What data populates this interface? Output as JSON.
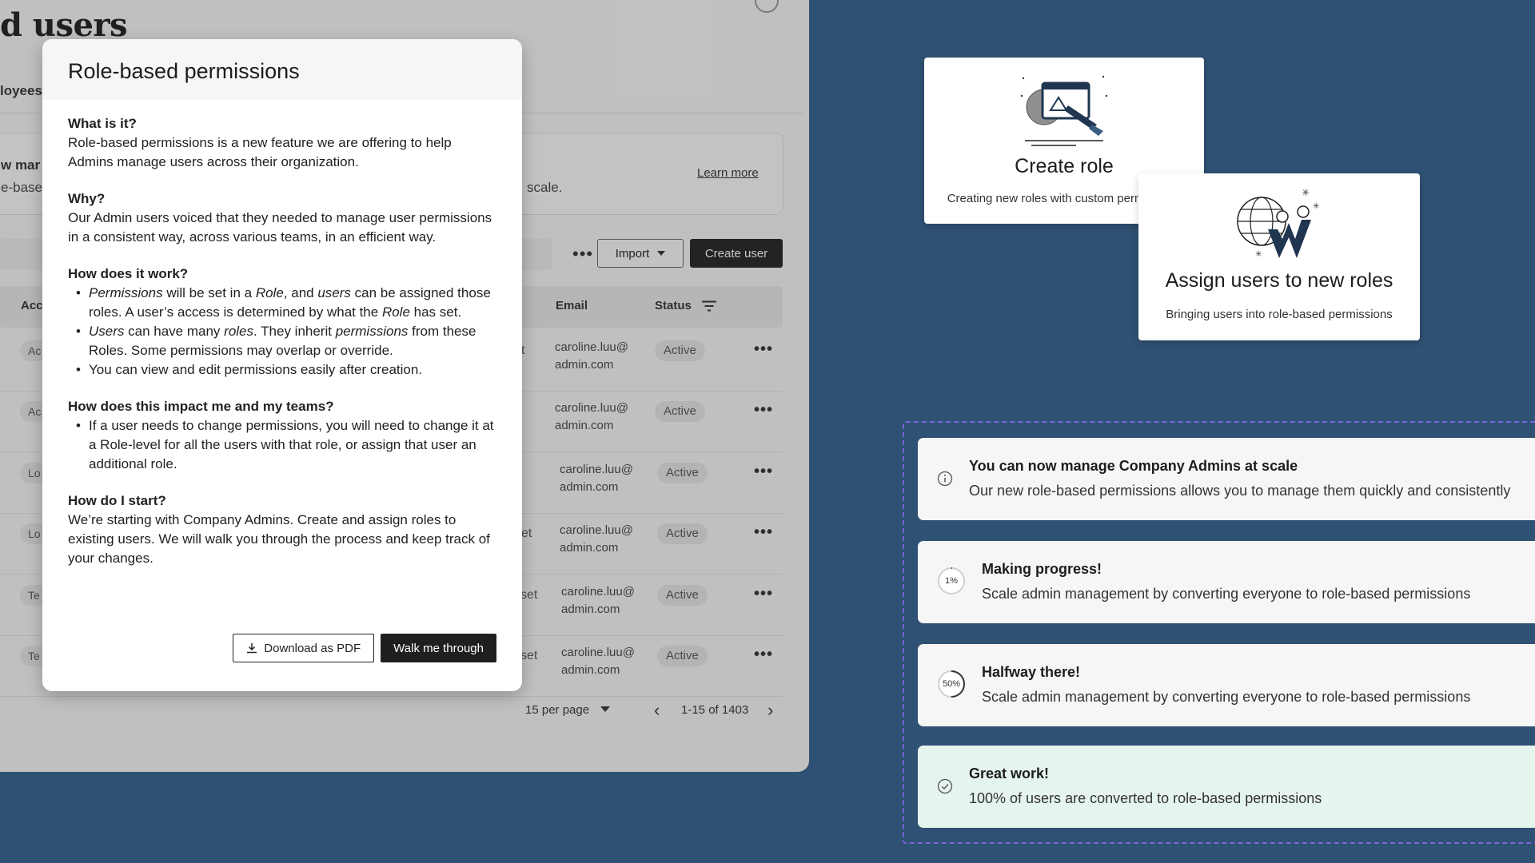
{
  "app": {
    "page_title": "d users",
    "tab_employees": "loyees",
    "banner": {
      "title": "w mar",
      "desc_left": "e-base",
      "desc_right": "scale.",
      "learn_more": "Learn more"
    },
    "toolbar": {
      "more": "•••",
      "import_label": "Import",
      "create_user_label": "Create user"
    },
    "table": {
      "columns": {
        "access": "Acc",
        "email": "Email",
        "status": "Status"
      },
      "rows": [
        {
          "access": "Ac",
          "extra": "t",
          "email": "caroline.luu@ admin.com",
          "status": "Active"
        },
        {
          "access": "Ac",
          "extra": "",
          "email": "caroline.luu@ admin.com",
          "status": "Active"
        },
        {
          "access": "Lo",
          "extra": "",
          "email": "caroline.luu@ admin.com",
          "status": "Active"
        },
        {
          "access": "Lo",
          "extra": "et",
          "email": "caroline.luu@ admin.com",
          "status": "Active"
        },
        {
          "access": "Te",
          "extra": "set",
          "email": "caroline.luu@ admin.com",
          "status": "Active"
        },
        {
          "access": "Te",
          "extra": "set",
          "email": "caroline.luu@ admin.com",
          "status": "Active"
        }
      ],
      "row_menu": "•••"
    },
    "pagination": {
      "per_page": "15 per page",
      "range": "1-15 of 1403",
      "prev": "‹",
      "next": "›"
    }
  },
  "modal": {
    "title": "Role-based permissions",
    "what_h": "What is it?",
    "what_p": "Role-based permissions is a new feature we are offering to help Admins manage users across their organization.",
    "why_h": "Why?",
    "why_p": "Our Admin users voiced that they needed to manage user permissions in a consistent way, across various teams, in an efficient way.",
    "how_h": "How does it work?",
    "how_b3": "You can view and edit permissions easily after creation.",
    "impact_h": "How does this impact me and my teams?",
    "impact_b1": "If a user needs to change permissions, you will need to change it at a Role-level for all the users with that role, or assign that user an additional role.",
    "start_h": "How do I start?",
    "start_p": "We’re starting with Company Admins. Create and assign roles to existing users. We will walk you through the process and keep track of your changes.",
    "btn_pdf": "Download as PDF",
    "btn_walk": "Walk me through",
    "b1": {
      "p1": "Permissions",
      "p2": " will be set in a ",
      "p3": "Role",
      "p4": ", and ",
      "p5": "users",
      "p6": " can be assigned those roles. A user’s access is determined by what the ",
      "p7": "Role",
      "p8": " has set."
    },
    "b2": {
      "p1": "Users",
      "p2": " can have many ",
      "p3": "roles",
      "p4": ". They inherit ",
      "p5": "permissions",
      "p6": " from these Roles. Some permissions may overlap or override."
    }
  },
  "cards": {
    "create": {
      "title": "Create role",
      "desc": "Creating new roles with custom permissions"
    },
    "assign": {
      "title": "Assign users to new roles",
      "desc": "Bringing users into role-based permissions"
    }
  },
  "notifications": [
    {
      "kind": "info",
      "title": "You can now manage Company Admins at scale",
      "desc": "Our new role-based permissions allows you to manage them quickly and consistently"
    },
    {
      "kind": "progress",
      "progress_label": "1%",
      "progress": 0.01,
      "title": "Making progress!",
      "desc": "Scale admin management by converting everyone to role-based permissions"
    },
    {
      "kind": "progress",
      "progress_label": "50%",
      "progress": 0.5,
      "title": "Halfway there!",
      "desc": "Scale admin management by converting everyone to role-based permissions"
    },
    {
      "kind": "success",
      "title": "Great work!",
      "desc": "100% of users are converted to role-based permissions"
    }
  ],
  "colors": {
    "background": "#2f5173",
    "success_bg": "#e6f4ee",
    "dashed_outline": "#7b62e0",
    "primary_button": "#1f1f1f"
  }
}
